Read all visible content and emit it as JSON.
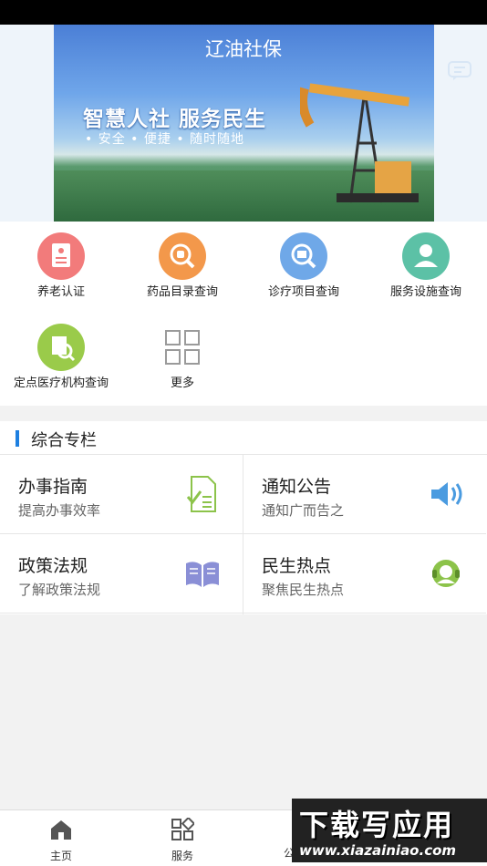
{
  "app": {
    "title": "辽油社保"
  },
  "banner": {
    "slogan": "智慧人社  服务民生",
    "slogan_sub": "• 安全  • 便捷  • 随时随地"
  },
  "services": [
    {
      "label": "养老认证",
      "icon": "pension-certificate-icon",
      "color": "#f27b7b"
    },
    {
      "label": "药品目录查询",
      "icon": "medicine-search-icon",
      "color": "#f3984b"
    },
    {
      "label": "诊疗项目查询",
      "icon": "treatment-search-icon",
      "color": "#6fa8e8"
    },
    {
      "label": "服务设施查询",
      "icon": "facility-search-icon",
      "color": "#5cc1a6"
    },
    {
      "label": "定点医疗机构查询",
      "icon": "hospital-search-icon",
      "color": "#9acb4a"
    },
    {
      "label": "更多",
      "icon": "more-grid-icon",
      "color": "#9a9a9a"
    }
  ],
  "section": {
    "title": "综合专栏"
  },
  "cards": [
    {
      "title": "办事指南",
      "subtitle": "提高办事效率",
      "icon": "checklist-icon",
      "color": "#8cc34a"
    },
    {
      "title": "通知公告",
      "subtitle": "通知广而告之",
      "icon": "speaker-icon",
      "color": "#4a9be0"
    },
    {
      "title": "政策法规",
      "subtitle": "了解政策法规",
      "icon": "book-icon",
      "color": "#8a8fd6"
    },
    {
      "title": "民生热点",
      "subtitle": "聚焦民生热点",
      "icon": "headset-icon",
      "color": "#8cc34a"
    }
  ],
  "tabbar": [
    {
      "label": "主页",
      "icon": "home-icon"
    },
    {
      "label": "服务",
      "icon": "services-icon"
    },
    {
      "label": "公",
      "icon": "notice-icon"
    }
  ],
  "watermark": {
    "line1": "下载写应用",
    "line2": "www.xiazainiao.com"
  }
}
